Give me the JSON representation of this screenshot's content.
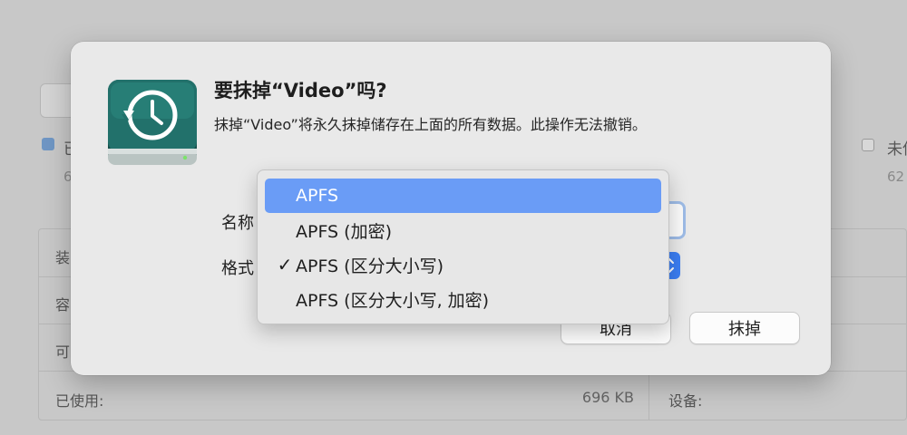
{
  "background": {
    "swatch_label": "已",
    "swatch_sub": "6",
    "check_label": "未使",
    "check_sub": "62",
    "rows": [
      {
        "label": "装"
      },
      {
        "label": "容"
      },
      {
        "label": "可"
      },
      {
        "label": "已使用:",
        "value": "696 KB",
        "right_label": "设备:"
      }
    ]
  },
  "dialog": {
    "title": "要抹掉“Video”吗?",
    "message": "抹掉“Video”将永久抹掉储存在上面的所有数据。此操作无法撤销。",
    "name_label": "名称",
    "format_label": "格式",
    "cancel_label": "取消",
    "erase_label": "抹掉",
    "icon": "time-machine-disk-icon"
  },
  "menu": {
    "items": [
      {
        "label": "APFS",
        "checked": false,
        "highlighted": true
      },
      {
        "label": "APFS (加密)",
        "checked": false,
        "highlighted": false
      },
      {
        "label": "APFS (区分大小写)",
        "checked": true,
        "highlighted": false
      },
      {
        "label": "APFS (区分大小写, 加密)",
        "checked": false,
        "highlighted": false
      }
    ],
    "check_glyph": "✓"
  },
  "colors": {
    "highlight": "#6a9cf6",
    "select_accent": "#3b7ef3",
    "disk_body": "#1f6b65"
  }
}
